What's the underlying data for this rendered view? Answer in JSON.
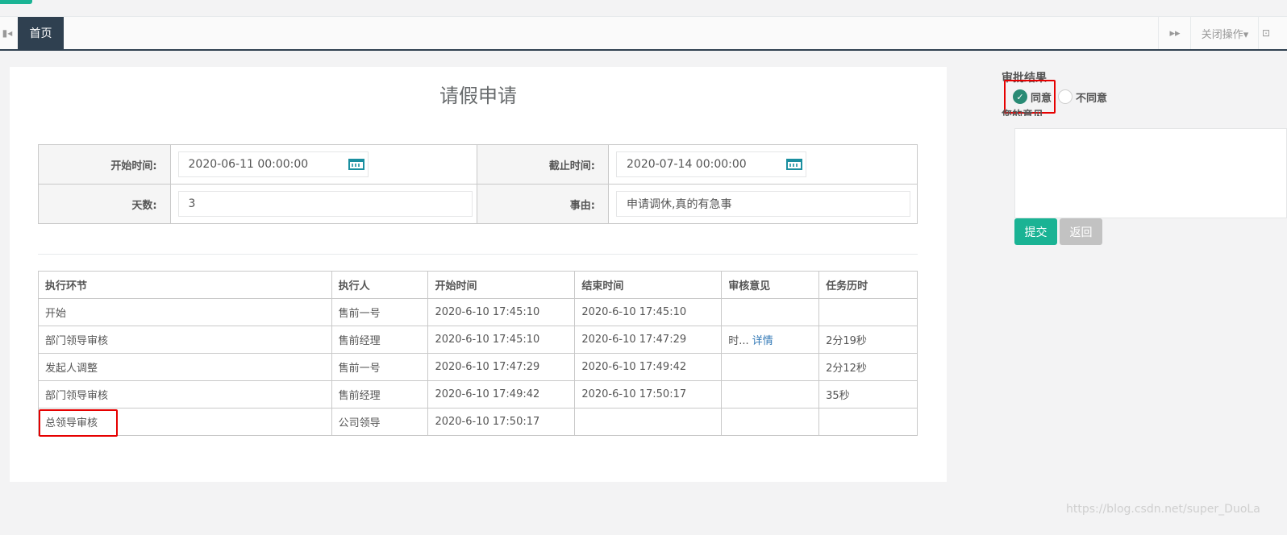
{
  "tabbar": {
    "home_tab": "首页",
    "close_ops": "关闭操作▾",
    "prev_icon": "▮◂",
    "next_icon": "▸▸",
    "full_icon": "⊡"
  },
  "form": {
    "title": "请假申请",
    "start_label": "开始时间:",
    "start_value": "2020-06-11 00:00:00",
    "end_label": "截止时间:",
    "end_value": "2020-07-14 00:00:00",
    "days_label": "天数:",
    "days_value": "3",
    "reason_label": "事由:",
    "reason_value": "申请调休,真的有急事"
  },
  "history": {
    "headers": [
      "执行环节",
      "执行人",
      "开始时间",
      "结束时间",
      "审核意见",
      "任务历时"
    ],
    "rows": [
      [
        "开始",
        "售前一号",
        "2020-6-10 17:45:10",
        "2020-6-10 17:45:10",
        "",
        ""
      ],
      [
        "部门领导审核",
        "售前经理",
        "2020-6-10 17:45:10",
        "2020-6-10 17:47:29",
        "时...",
        "2分19秒"
      ],
      [
        "发起人调整",
        "售前一号",
        "2020-6-10 17:47:29",
        "2020-6-10 17:49:42",
        "",
        "2分12秒"
      ],
      [
        "部门领导审核",
        "售前经理",
        "2020-6-10 17:49:42",
        "2020-6-10 17:50:17",
        "",
        "35秒"
      ],
      [
        "总领导审核",
        "公司领导",
        "2020-6-10 17:50:17",
        "",
        "",
        ""
      ]
    ],
    "detail_link": "详情"
  },
  "approval": {
    "title": "审批结果",
    "agree": "同意",
    "disagree": "不同意",
    "opinion_label": "您的意见",
    "submit": "提交",
    "back": "返回"
  },
  "watermark": "https://blog.csdn.net/super_DuoLa",
  "colors": {
    "accent": "#1ab394",
    "nav": "#2f4050",
    "highlight": "#e60000"
  }
}
